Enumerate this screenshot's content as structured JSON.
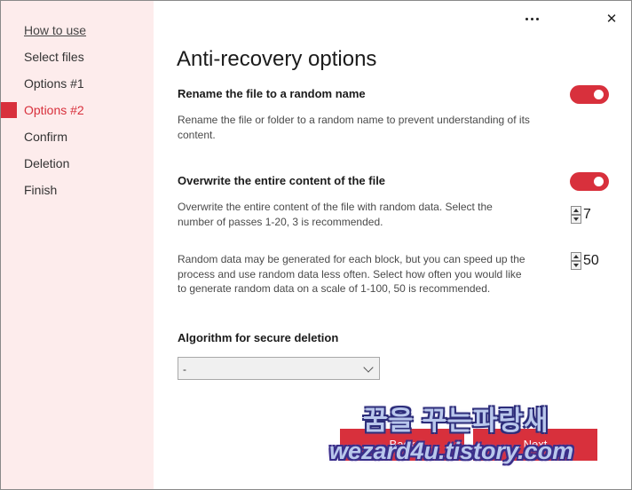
{
  "sidebar": {
    "items": [
      {
        "label": "How to use"
      },
      {
        "label": "Select files"
      },
      {
        "label": "Options #1"
      },
      {
        "label": "Options #2"
      },
      {
        "label": "Confirm"
      },
      {
        "label": "Deletion"
      },
      {
        "label": "Finish"
      }
    ],
    "active_index": 3
  },
  "titlebar": {
    "more_icon": "more-horizontal-icon",
    "close_icon": "close-icon",
    "close_glyph": "✕"
  },
  "main": {
    "title": "Anti-recovery options",
    "rename": {
      "title": "Rename the file to a random name",
      "description": "Rename the file or folder to a random name to prevent understanding of its content.",
      "enabled": true
    },
    "overwrite": {
      "title": "Overwrite the entire content of the file",
      "enabled": true,
      "passes_description": "Overwrite the entire content of the file with random data. Select the number of passes 1-20, 3 is recommended.",
      "passes_value": "7",
      "random_description": "Random data may be generated for each block, but you can speed up the process and use random data less often. Select how often you would like to generate random data on a scale of 1-100, 50 is recommended.",
      "random_value": "50"
    },
    "algorithm": {
      "label": "Algorithm for secure deletion",
      "selected": "-"
    }
  },
  "footer": {
    "back_label": "Back",
    "next_label": "Next"
  },
  "watermark": {
    "line1": "꿈을 꾸는파랑새",
    "line2": "wezard4u.tistory.com"
  },
  "colors": {
    "accent": "#d8303c",
    "sidebar_bg": "#fdecec"
  }
}
